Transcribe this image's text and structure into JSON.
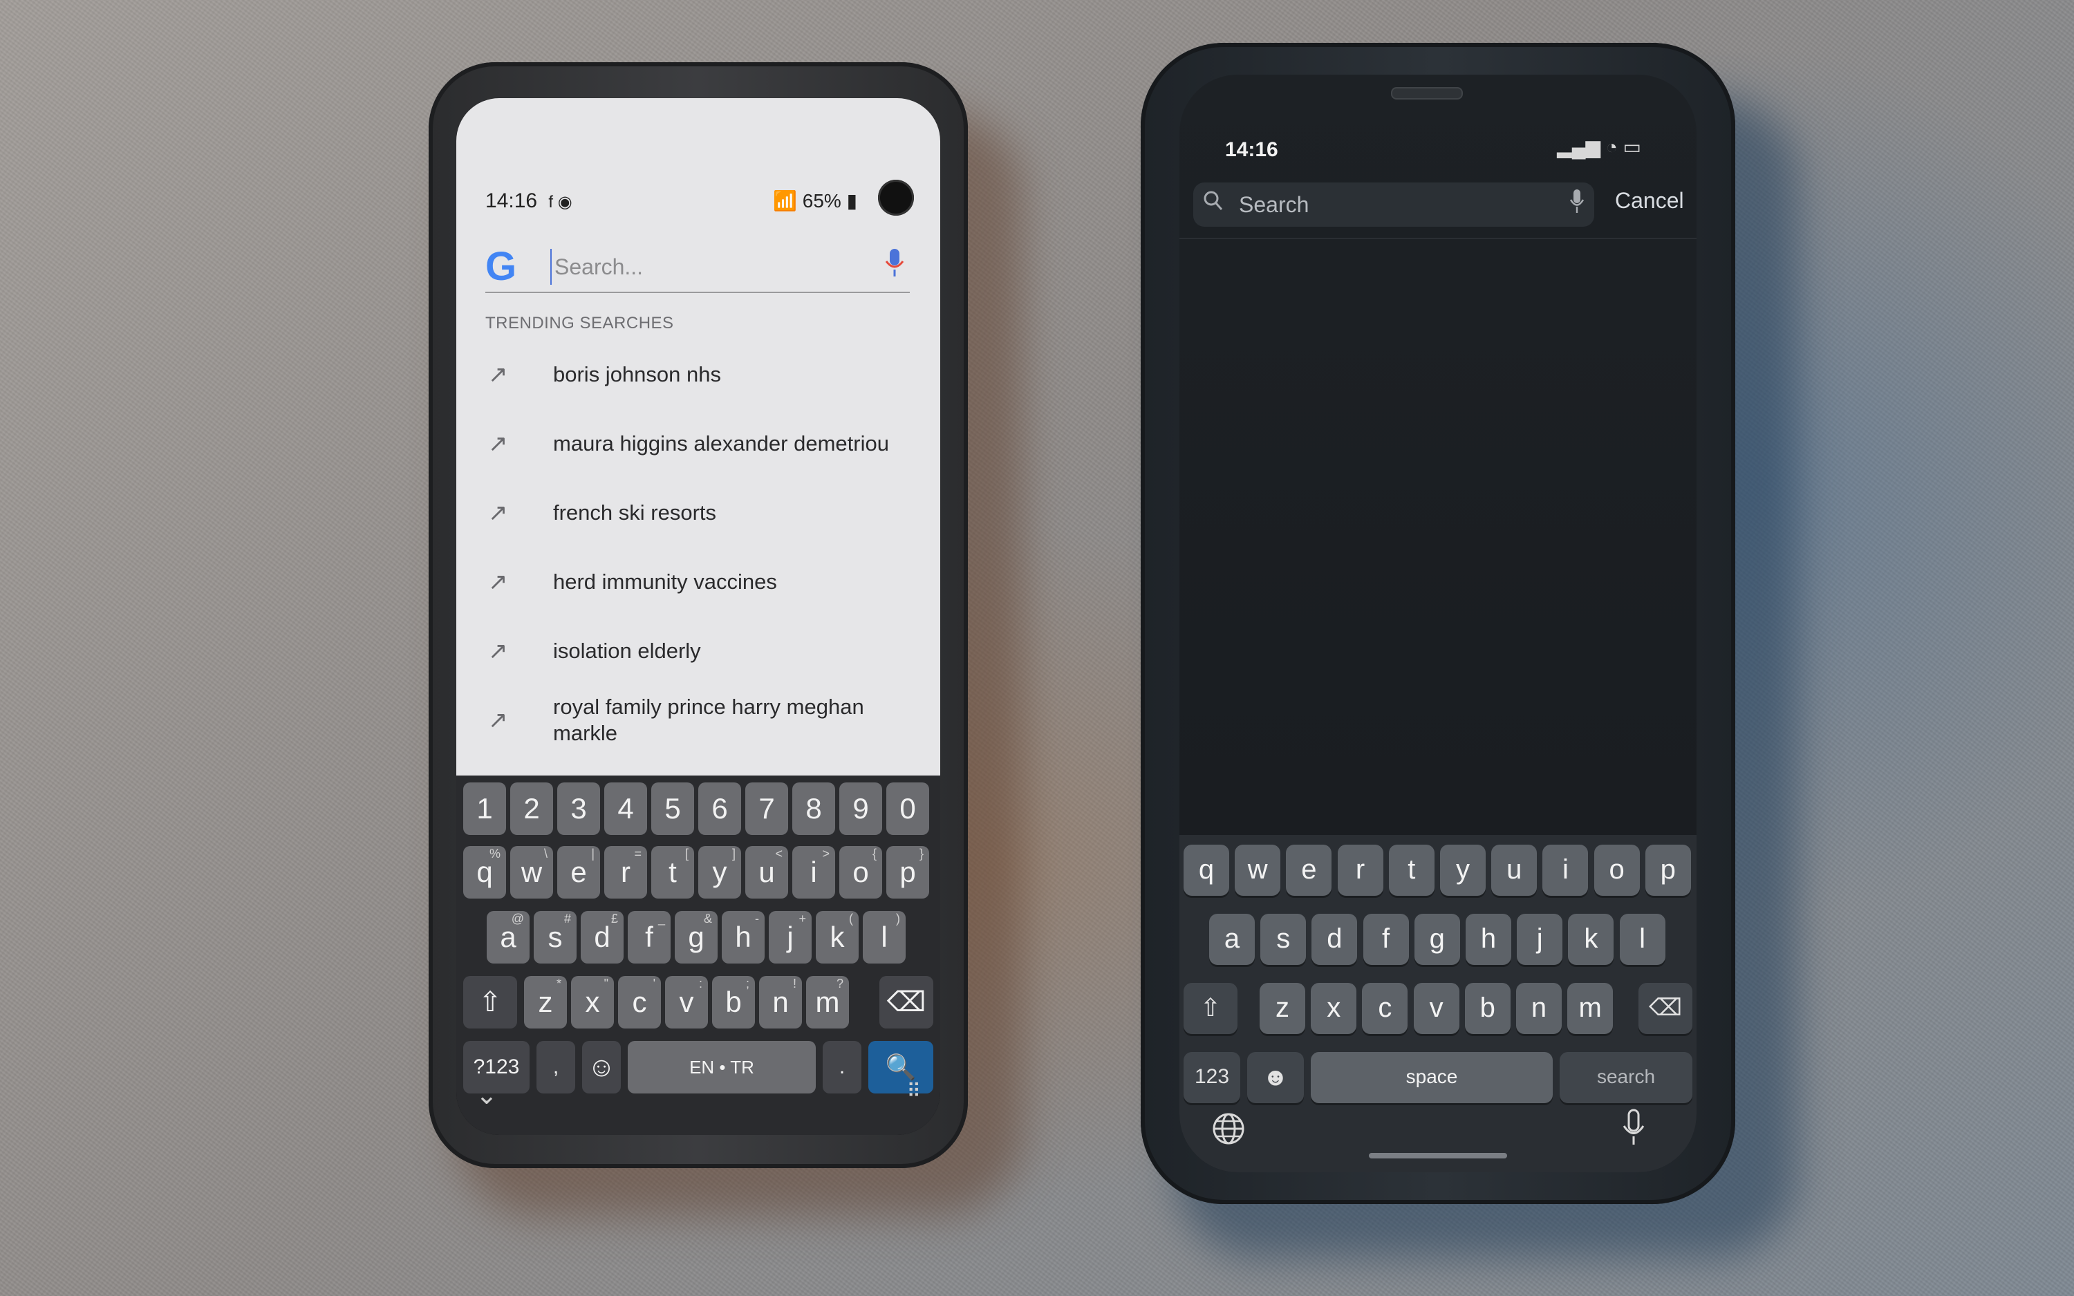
{
  "android": {
    "status": {
      "time": "14:16",
      "notif_icons": "f ◉",
      "right": "📶 65% ▮"
    },
    "search": {
      "placeholder": "Search...",
      "logo": "G"
    },
    "trending_header": "TRENDING SEARCHES",
    "trending": [
      "boris johnson nhs",
      "maura higgins alexander demetriou",
      "french ski resorts",
      "herd immunity vaccines",
      "isolation elderly",
      "royal family prince harry meghan markle"
    ],
    "keyboard": {
      "numbers": [
        "1",
        "2",
        "3",
        "4",
        "5",
        "6",
        "7",
        "8",
        "9",
        "0"
      ],
      "row1": [
        [
          "q",
          "%"
        ],
        [
          "w",
          "\\"
        ],
        [
          "e",
          "|"
        ],
        [
          "r",
          "="
        ],
        [
          "t",
          "["
        ],
        [
          "y",
          "]"
        ],
        [
          "u",
          "<"
        ],
        [
          "i",
          ">"
        ],
        [
          "o",
          "{"
        ],
        [
          "p",
          "}"
        ]
      ],
      "row2": [
        [
          "a",
          "@"
        ],
        [
          "s",
          "#"
        ],
        [
          "d",
          "£"
        ],
        [
          "f",
          "_"
        ],
        [
          "g",
          "&"
        ],
        [
          "h",
          "-"
        ],
        [
          "j",
          "+"
        ],
        [
          "k",
          "("
        ],
        [
          "l",
          ")"
        ]
      ],
      "row3": [
        [
          "z",
          "*"
        ],
        [
          "x",
          "\""
        ],
        [
          "c",
          "'"
        ],
        [
          "v",
          ":"
        ],
        [
          "b",
          ";"
        ],
        [
          "n",
          "!"
        ],
        [
          "m",
          "?"
        ]
      ],
      "symbols_key": "?123",
      "comma_key": ",",
      "lang_key": "EN • TR",
      "period_key": ".",
      "shift_icon": "⇧",
      "backspace_icon": "⌫",
      "emoji_icon": "☺",
      "search_icon": "🔍",
      "collapse_icon": "⌄",
      "grid_icon": "⠿"
    }
  },
  "ios": {
    "status": {
      "time": "14:16",
      "right": "▂▄▆ ◔ ▭"
    },
    "search": {
      "label": "Search",
      "cancel": "Cancel"
    },
    "keyboard": {
      "row1": [
        "q",
        "w",
        "e",
        "r",
        "t",
        "y",
        "u",
        "i",
        "o",
        "p"
      ],
      "row2": [
        "a",
        "s",
        "d",
        "f",
        "g",
        "h",
        "j",
        "k",
        "l"
      ],
      "row3": [
        "z",
        "x",
        "c",
        "v",
        "b",
        "n",
        "m"
      ],
      "numbers_key": "123",
      "space_key": "space",
      "search_key": "search",
      "shift_icon": "⇧",
      "backspace_icon": "⌫",
      "emoji_icon": "☻",
      "globe_icon": "🌐",
      "mic_icon": "🎤"
    }
  }
}
